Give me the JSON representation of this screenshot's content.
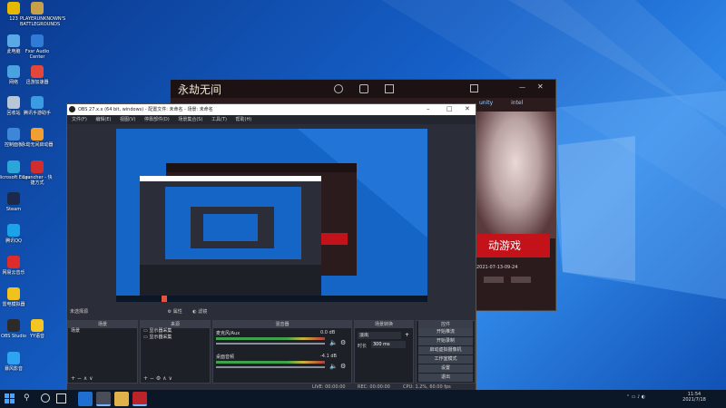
{
  "desktop": {
    "icons": [
      {
        "label": "123",
        "color": "#e6b800"
      },
      {
        "label": "PLAYERUNKNOWN'S BATTLEGROUNDS",
        "color": "#c9a04a"
      },
      {
        "label": "此电脑",
        "color": "#5aa9e6"
      },
      {
        "label": "Fxsr Audio Center",
        "color": "#2f7bd6"
      },
      {
        "label": "网络",
        "color": "#4aa3df"
      },
      {
        "label": "迅游加速器",
        "color": "#e4463a"
      },
      {
        "label": "回收站",
        "color": "#b8c7d6"
      },
      {
        "label": "腾讯手游助手",
        "color": "#3a9be0"
      },
      {
        "label": "控制面板",
        "color": "#3e86d8"
      },
      {
        "label": "永劫无间启动器",
        "color": "#f0a030"
      },
      {
        "label": "Microsoft Edge",
        "color": "#2aa6d9"
      },
      {
        "label": "Launcher - 快捷方式",
        "color": "#d22d2d"
      },
      {
        "label": "Steam",
        "color": "#1b2a4a"
      },
      {
        "label": "腾讯QQ",
        "color": "#1aa3e8"
      },
      {
        "label": "网易云音乐",
        "color": "#e02b2b"
      },
      {
        "label": "雷电模拟器",
        "color": "#f1c21b"
      },
      {
        "label": "OBS Studio",
        "color": "#2b2b2b"
      },
      {
        "label": "YY语音",
        "color": "#f3c623"
      },
      {
        "label": "暴风影音",
        "color": "#2ea3ef"
      }
    ]
  },
  "taskbar": {
    "time": "11:54",
    "date": "2021/7/18",
    "apps": [
      "start-icon",
      "search-icon",
      "taskview-icon",
      "edge-icon",
      "obs-icon",
      "explorer-icon",
      "game-icon"
    ]
  },
  "game_window": {
    "logo_text": "永劫无间",
    "banner_text": "动游戏",
    "date_text": "2021-07-13-09-24",
    "brand_labels": [
      "unity",
      "intel"
    ]
  },
  "obs": {
    "title": "OBS 27.x.x (64 bit, windows) - 配置文件: 未命名 - 场景: 未命名",
    "menu": [
      "文件(F)",
      "编辑(E)",
      "视图(V)",
      "停靠部件(D)",
      "场景集合(S)",
      "工具(T)",
      "帮助(H)"
    ],
    "source_bar": {
      "label": "未选择源",
      "btn1": "属性",
      "btn2": "滤镜"
    },
    "docks": {
      "scenes": {
        "title": "场景",
        "items": [
          "场景"
        ]
      },
      "sources": {
        "title": "来源",
        "items": [
          "显示器采集",
          "显示器采集"
        ]
      },
      "mixer": {
        "title": "混音器",
        "channels": [
          {
            "name": "麦克风/Aux",
            "db": "0.0 dB"
          },
          {
            "name": "桌面音频",
            "db": "-4.1 dB"
          }
        ]
      },
      "transitions": {
        "title": "场景转换",
        "type": "淡出",
        "duration_label": "时长",
        "duration": "300 ms"
      },
      "controls": {
        "title": "控件",
        "buttons": [
          "开始推流",
          "开始录制",
          "启动虚拟摄像机",
          "工作室模式",
          "设置",
          "退出"
        ]
      }
    },
    "status": {
      "live": "LIVE: 00:00:00",
      "rec": "REC: 00:00:00",
      "cpu": "CPU: 1.2%, 60.00 fps"
    }
  }
}
